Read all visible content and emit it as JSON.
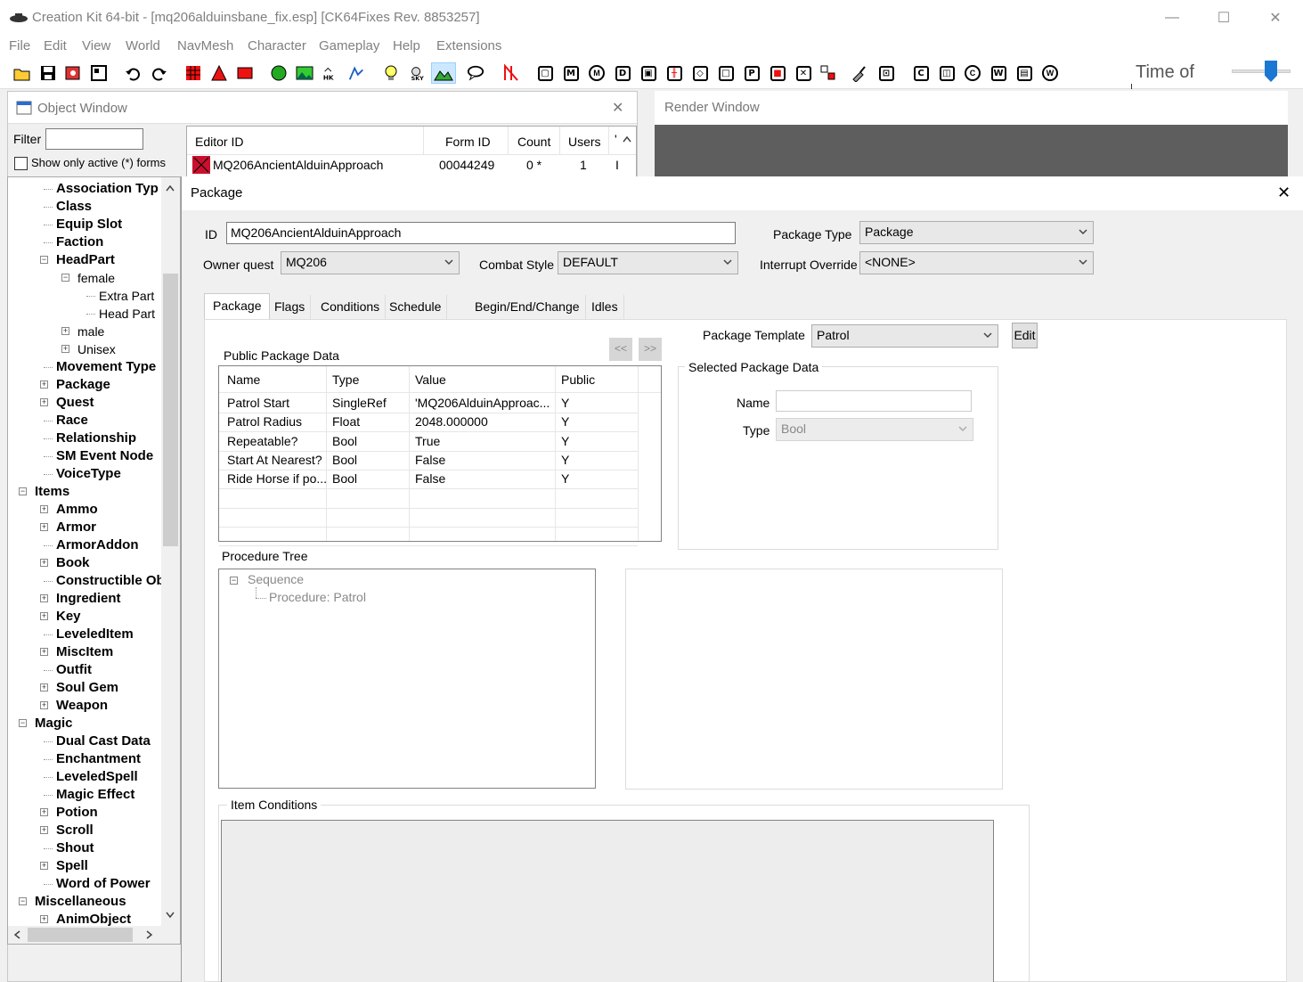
{
  "app": {
    "title": "Creation Kit 64-bit - [mq206alduinsbane_fix.esp] [CK64Fixes Rev. 8853257]",
    "window_controls": {
      "minimize": "—",
      "maximize": "☐",
      "close": "✕"
    }
  },
  "menu": [
    "File",
    "Edit",
    "View",
    "World",
    "NavMesh",
    "Character",
    "Gameplay",
    "Help",
    "Extensions"
  ],
  "toolbar": {
    "time_label": "Time of",
    "letter_icons": [
      "M",
      "D",
      "C",
      "P",
      "C",
      "W"
    ]
  },
  "object_window": {
    "title": "Object Window",
    "close": "✕",
    "filter_label": "Filter",
    "filter_value": "",
    "active_only_label": "Show only active (*) forms",
    "columns": [
      "Editor ID",
      "Form ID",
      "Count",
      "Users",
      "'"
    ],
    "rows": [
      {
        "editor_id": "MQ206AncientAlduinApproach",
        "form_id": "00044249",
        "count": "0 *",
        "users": "1",
        "extra": "I"
      }
    ],
    "tree": [
      {
        "label": "Association Typ",
        "level": 2,
        "exp": ""
      },
      {
        "label": "Class",
        "level": 2,
        "exp": ""
      },
      {
        "label": "Equip Slot",
        "level": 2,
        "exp": ""
      },
      {
        "label": "Faction",
        "level": 2,
        "exp": ""
      },
      {
        "label": "HeadPart",
        "level": 2,
        "exp": "−"
      },
      {
        "label": "female",
        "level": 3,
        "exp": "−",
        "normal": true
      },
      {
        "label": "Extra Part",
        "level": 4,
        "exp": "",
        "normal": true
      },
      {
        "label": "Head Part",
        "level": 4,
        "exp": "",
        "normal": true
      },
      {
        "label": "male",
        "level": 3,
        "exp": "+",
        "normal": true
      },
      {
        "label": "Unisex",
        "level": 3,
        "exp": "+",
        "normal": true
      },
      {
        "label": "Movement Type",
        "level": 2,
        "exp": ""
      },
      {
        "label": "Package",
        "level": 2,
        "exp": "+"
      },
      {
        "label": "Quest",
        "level": 2,
        "exp": "+"
      },
      {
        "label": "Race",
        "level": 2,
        "exp": ""
      },
      {
        "label": "Relationship",
        "level": 2,
        "exp": ""
      },
      {
        "label": "SM Event Node",
        "level": 2,
        "exp": ""
      },
      {
        "label": "VoiceType",
        "level": 2,
        "exp": ""
      },
      {
        "label": "Items",
        "level": 1,
        "exp": "−"
      },
      {
        "label": "Ammo",
        "level": 2,
        "exp": "+"
      },
      {
        "label": "Armor",
        "level": 2,
        "exp": "+"
      },
      {
        "label": "ArmorAddon",
        "level": 2,
        "exp": ""
      },
      {
        "label": "Book",
        "level": 2,
        "exp": "+"
      },
      {
        "label": "Constructible Ob",
        "level": 2,
        "exp": ""
      },
      {
        "label": "Ingredient",
        "level": 2,
        "exp": "+"
      },
      {
        "label": "Key",
        "level": 2,
        "exp": "+"
      },
      {
        "label": "LeveledItem",
        "level": 2,
        "exp": ""
      },
      {
        "label": "MiscItem",
        "level": 2,
        "exp": "+"
      },
      {
        "label": "Outfit",
        "level": 2,
        "exp": ""
      },
      {
        "label": "Soul Gem",
        "level": 2,
        "exp": "+"
      },
      {
        "label": "Weapon",
        "level": 2,
        "exp": "+"
      },
      {
        "label": "Magic",
        "level": 1,
        "exp": "−"
      },
      {
        "label": "Dual Cast Data",
        "level": 2,
        "exp": ""
      },
      {
        "label": "Enchantment",
        "level": 2,
        "exp": ""
      },
      {
        "label": "LeveledSpell",
        "level": 2,
        "exp": ""
      },
      {
        "label": "Magic Effect",
        "level": 2,
        "exp": ""
      },
      {
        "label": "Potion",
        "level": 2,
        "exp": "+"
      },
      {
        "label": "Scroll",
        "level": 2,
        "exp": "+"
      },
      {
        "label": "Shout",
        "level": 2,
        "exp": ""
      },
      {
        "label": "Spell",
        "level": 2,
        "exp": "+"
      },
      {
        "label": "Word of Power",
        "level": 2,
        "exp": ""
      },
      {
        "label": "Miscellaneous",
        "level": 1,
        "exp": "−"
      },
      {
        "label": "AnimObject",
        "level": 2,
        "exp": "+"
      }
    ]
  },
  "render_window": {
    "title": "Render Window"
  },
  "package_dialog": {
    "title": "Package",
    "close": "✕",
    "id_label": "ID",
    "id_value": "MQ206AncientAlduinApproach",
    "package_type_label": "Package Type",
    "package_type_value": "Package",
    "owner_quest_label": "Owner quest",
    "owner_quest_value": "MQ206",
    "combat_style_label": "Combat Style",
    "combat_style_value": "DEFAULT",
    "interrupt_label": "Interrupt Override",
    "interrupt_value": "<NONE>",
    "tabs": [
      "Package",
      "Flags",
      "Conditions",
      "Schedule",
      "Begin/End/Change",
      "Idles"
    ],
    "template_label": "Package Template",
    "template_value": "Patrol",
    "edit_button": "Edit",
    "nav_prev": "<<",
    "nav_next": ">>",
    "public_data_label": "Public Package Data",
    "public_columns": [
      "Name",
      "Type",
      "Value",
      "Public"
    ],
    "public_rows": [
      {
        "name": "Patrol Start",
        "type": "SingleRef",
        "value": "'MQ206AlduinApproac...",
        "public": "Y"
      },
      {
        "name": "Patrol Radius",
        "type": "Float",
        "value": "2048.000000",
        "public": "Y"
      },
      {
        "name": "Repeatable?",
        "type": "Bool",
        "value": "True",
        "public": "Y"
      },
      {
        "name": "Start At Nearest?",
        "type": "Bool",
        "value": "False",
        "public": "Y"
      },
      {
        "name": "Ride Horse if po...",
        "type": "Bool",
        "value": "False",
        "public": "Y"
      }
    ],
    "selected_data_label": "Selected Package Data",
    "sel_name_label": "Name",
    "sel_name_value": "",
    "sel_type_label": "Type",
    "sel_type_value": "Bool",
    "procedure_tree_label": "Procedure Tree",
    "procedure_nodes": [
      "Sequence",
      "Procedure: Patrol"
    ],
    "item_conditions_label": "Item Conditions"
  }
}
